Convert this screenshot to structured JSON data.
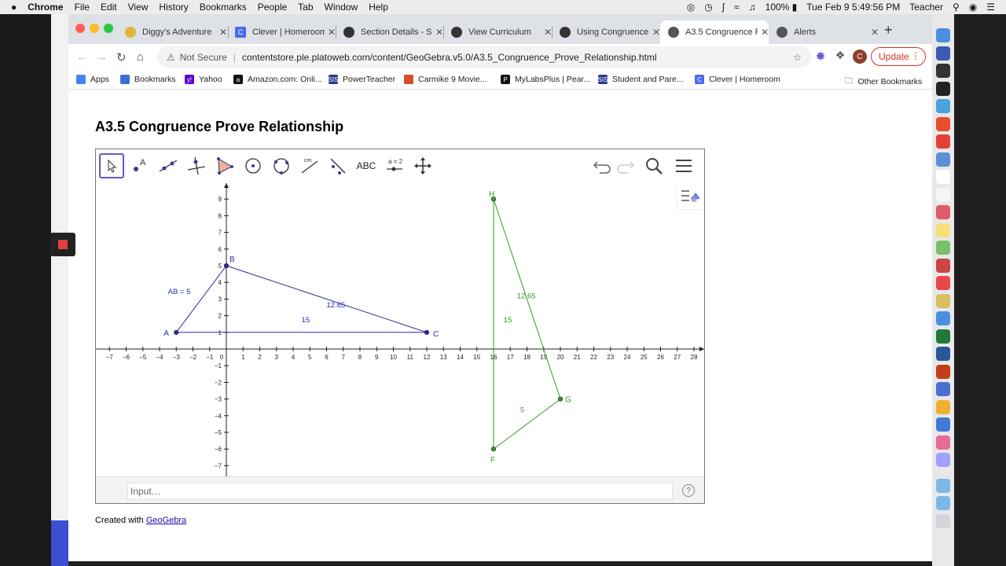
{
  "menubar": {
    "apple": "",
    "app_name": "Chrome",
    "items": [
      "File",
      "Edit",
      "View",
      "History",
      "Bookmarks",
      "People",
      "Tab",
      "Window",
      "Help"
    ],
    "battery": "100%",
    "datetime": "Tue Feb 9  5:49:56 PM",
    "user": "Teacher"
  },
  "tabs": [
    {
      "title": "Diggy's Adventure",
      "icon_color": "#e2b43a"
    },
    {
      "title": "Clever | Homeroom",
      "icon_color": "#4a68f0"
    },
    {
      "title": "Section Details - St",
      "icon_color": "#333333"
    },
    {
      "title": "View Curriculum",
      "icon_color": "#333333"
    },
    {
      "title": "Using Congruence",
      "icon_color": "#333333"
    },
    {
      "title": "A3.5 Congruence P",
      "icon_color": "#555555"
    },
    {
      "title": "Alerts",
      "icon_color": "#555555"
    }
  ],
  "toolbar": {
    "not_secure": "Not Secure",
    "url": "contentstore.ple.platoweb.com/content/GeoGebra.v5.0/A3.5_Congruence_Prove_Relationship.html",
    "update_label": "Update",
    "avatar_letter": "C"
  },
  "bookmarks": [
    {
      "label": "Apps",
      "icon_color": "#4285f4"
    },
    {
      "label": "Bookmarks",
      "icon_color": "#3b6fd6"
    },
    {
      "label": "Yahoo",
      "icon_color": "#5f01d1"
    },
    {
      "label": "Amazon.com: Onli...",
      "icon_color": "#111111"
    },
    {
      "label": "PowerTeacher",
      "icon_color": "#2b3a8f"
    },
    {
      "label": "Carmike 9 Movie...",
      "icon_color": "#d94b2b"
    },
    {
      "label": "MyLabsPlus | Pear...",
      "icon_color": "#111111"
    },
    {
      "label": "Student and Pare...",
      "icon_color": "#2b3a8f"
    },
    {
      "label": "Clever | Homeroom",
      "icon_color": "#4a68f0"
    }
  ],
  "other_bookmarks": "Other Bookmarks",
  "page": {
    "title": "A3.5 Congruence Prove Relationship",
    "created_with": "Created with ",
    "geogebra_link": "GeoGebra"
  },
  "geogebra": {
    "input_placeholder": "Input…",
    "help": "?",
    "tools": [
      "move",
      "point",
      "line",
      "perpendicular",
      "polygon",
      "circle",
      "circle-three-points",
      "measure",
      "reflect",
      "text",
      "slider",
      "move-view"
    ],
    "text_tool_label": "ABC",
    "slider_tool_label": "a = 2",
    "measure_tool_label": "cm"
  },
  "graph": {
    "x_ticks": [
      -7,
      -6,
      -5,
      -4,
      -3,
      -2,
      -1,
      0,
      1,
      2,
      3,
      4,
      5,
      6,
      7,
      8,
      9,
      10,
      11,
      12,
      13,
      14,
      15,
      16,
      17,
      18,
      19,
      20,
      21,
      22,
      23,
      24,
      25,
      26,
      27,
      28
    ],
    "y_ticks": [
      9,
      8,
      7,
      6,
      5,
      4,
      3,
      2,
      1,
      -1,
      -2,
      -3,
      -4,
      -5,
      -6,
      -7
    ],
    "triangle_abc": {
      "color": "#2a2aa6",
      "points": [
        {
          "name": "A",
          "x": -3,
          "y": 1
        },
        {
          "name": "B",
          "x": 0,
          "y": 5
        },
        {
          "name": "C",
          "x": 12,
          "y": 1
        }
      ],
      "labels": {
        "ab": "AB = 5",
        "bc": "12.65",
        "ac": "15"
      }
    },
    "triangle_fgh": {
      "color": "#3a9a2a",
      "points": [
        {
          "name": "F",
          "x": 16,
          "y": -6
        },
        {
          "name": "G",
          "x": 20,
          "y": -3
        },
        {
          "name": "H",
          "x": 16,
          "y": 9
        }
      ],
      "labels": {
        "fh": "15",
        "gh": "12.65",
        "fg": "5"
      }
    }
  }
}
